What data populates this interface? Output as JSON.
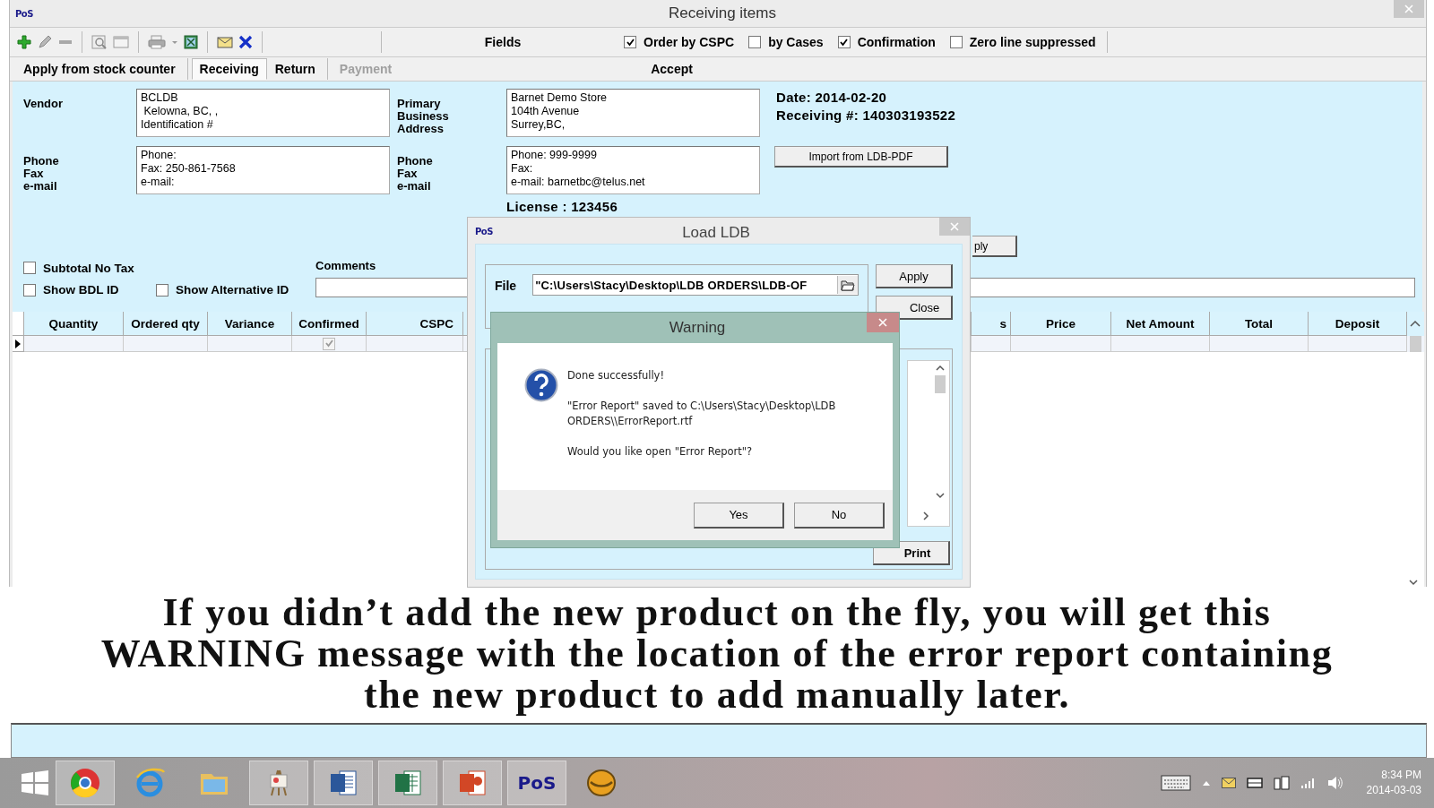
{
  "window": {
    "logo": "PoS",
    "title": "Receiving items"
  },
  "toolbar": {
    "fields_label": "Fields",
    "options": [
      {
        "label": "Order by CSPC",
        "checked": true
      },
      {
        "label": "by Cases",
        "checked": false
      },
      {
        "label": "Confirmation",
        "checked": true
      },
      {
        "label": "Zero line suppressed",
        "checked": false
      }
    ]
  },
  "tabs": [
    {
      "label": "Apply from stock counter",
      "selected": false,
      "disabled": false
    },
    {
      "label": "Receiving",
      "selected": true,
      "disabled": false
    },
    {
      "label": "Return",
      "selected": false,
      "disabled": false
    },
    {
      "label": "Payment",
      "selected": false,
      "disabled": true
    }
  ],
  "accept_label": "Accept",
  "vendor": {
    "label": "Vendor",
    "address": [
      "BCLDB",
      " Kelowna, BC, ,",
      "Identification #"
    ],
    "contact_labels": [
      "Phone",
      "Fax",
      "e-mail"
    ],
    "contact": [
      "Phone:",
      "Fax: 250-861-7568",
      "e-mail:"
    ]
  },
  "store": {
    "label": [
      "Primary",
      "Business",
      "Address"
    ],
    "address": [
      "Barnet Demo Store",
      "104th Avenue",
      "Surrey,BC,"
    ],
    "contact_labels": [
      "Phone",
      "Fax",
      "e-mail"
    ],
    "contact": [
      "Phone: 999-9999",
      "Fax:",
      "e-mail: barnetbc@telus.net"
    ],
    "license": "License :  123456"
  },
  "date": "Date: 2014-02-20",
  "receiving_number": "Receiving #: 140303193522",
  "import_button": "Import from LDB-PDF",
  "partial_button": "ply",
  "options": [
    {
      "label": "Subtotal No Tax",
      "checked": false
    },
    {
      "label": "Show BDL ID",
      "checked": false
    },
    {
      "label": "Show Alternative ID",
      "checked": false
    }
  ],
  "comments": {
    "label": "Comments"
  },
  "table": {
    "columns": [
      "Quantity",
      "Ordered qty",
      "Variance",
      "Confirmed",
      "CSPC",
      "s",
      "Price",
      "Net Amount",
      "Total",
      "Deposit"
    ],
    "rows": [
      {
        "current": true,
        "confirmed": true
      }
    ]
  },
  "load_dialog": {
    "logo": "PoS",
    "title": "Load LDB",
    "file_label": "File",
    "file_value": "\"C:\\Users\\Stacy\\Desktop\\LDB ORDERS\\LDB-OF",
    "buttons": [
      "Apply",
      "Close",
      "Print"
    ]
  },
  "warning_dialog": {
    "title": "Warning",
    "messages": [
      "Done successfully!",
      "\"Error Report\" saved to C:\\Users\\Stacy\\Desktop\\LDB ORDERS\\\\ErrorReport.rtf",
      "Would you like open \"Error Report\"?"
    ],
    "buttons": [
      "Yes",
      "No"
    ]
  },
  "caption": "If you didn’t add the new product on the fly, you will get this WARNING message with the location of the error report containing the new product to add manually later.",
  "taskbar": {
    "pos_label": "PoS",
    "time": "8:34 PM",
    "date": "2014-03-03"
  }
}
